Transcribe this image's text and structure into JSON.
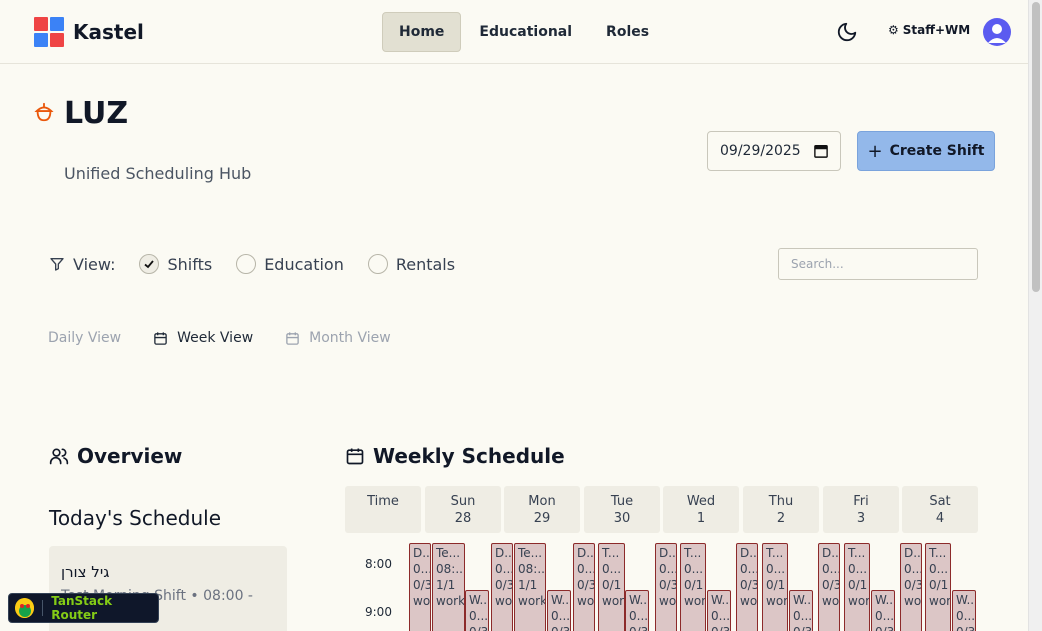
{
  "app": {
    "name": "Kastel"
  },
  "nav": {
    "links": [
      {
        "label": "Home"
      },
      {
        "label": "Educational"
      },
      {
        "label": "Roles"
      }
    ],
    "role_label": "Staff+WM"
  },
  "header": {
    "title": "LUZ",
    "subtitle": "Unified Scheduling Hub",
    "date_value": "09/29/2025",
    "create_label": "Create Shift"
  },
  "filters": {
    "view_label": "View:",
    "options": [
      {
        "label": "Shifts",
        "checked": true
      },
      {
        "label": "Education",
        "checked": false
      },
      {
        "label": "Rentals",
        "checked": false
      }
    ],
    "search_placeholder": "Search..."
  },
  "view_tabs": [
    {
      "label": "Daily View"
    },
    {
      "label": "Week View",
      "active": true
    },
    {
      "label": "Month View"
    }
  ],
  "overview": {
    "title": "Overview",
    "today_title": "Today's Schedule",
    "card": {
      "name": "גיל צורן",
      "detail": "Test Morning Shift • 08:00 -"
    }
  },
  "weekly": {
    "title": "Weekly Schedule",
    "time_header": "Time",
    "days": [
      {
        "name": "Sun",
        "date": "28"
      },
      {
        "name": "Mon",
        "date": "29"
      },
      {
        "name": "Tue",
        "date": "30"
      },
      {
        "name": "Wed",
        "date": "1"
      },
      {
        "name": "Thu",
        "date": "2"
      },
      {
        "name": "Fri",
        "date": "3"
      },
      {
        "name": "Sat",
        "date": "4"
      }
    ],
    "times": [
      "8:00",
      "9:00"
    ],
    "shift_rows": {
      "a": [
        "D...",
        "0...",
        "0/3",
        "wor"
      ],
      "sun_b": [
        "Te...",
        "08:...",
        "1/1",
        "work"
      ],
      "mon_b": [
        "Te...",
        "08:...",
        "1/1",
        "work"
      ],
      "b": [
        "T...",
        "0...",
        "0/1",
        "wor"
      ],
      "c": [
        "W...",
        "0...",
        "0/3"
      ]
    }
  },
  "devtools": {
    "label": "TanStack Router"
  },
  "colors": {
    "accent": "#93b8ea",
    "shift_border": "#8c2a2a",
    "shift_fill": "#dcc6c6",
    "background": "#fbfaf3"
  }
}
